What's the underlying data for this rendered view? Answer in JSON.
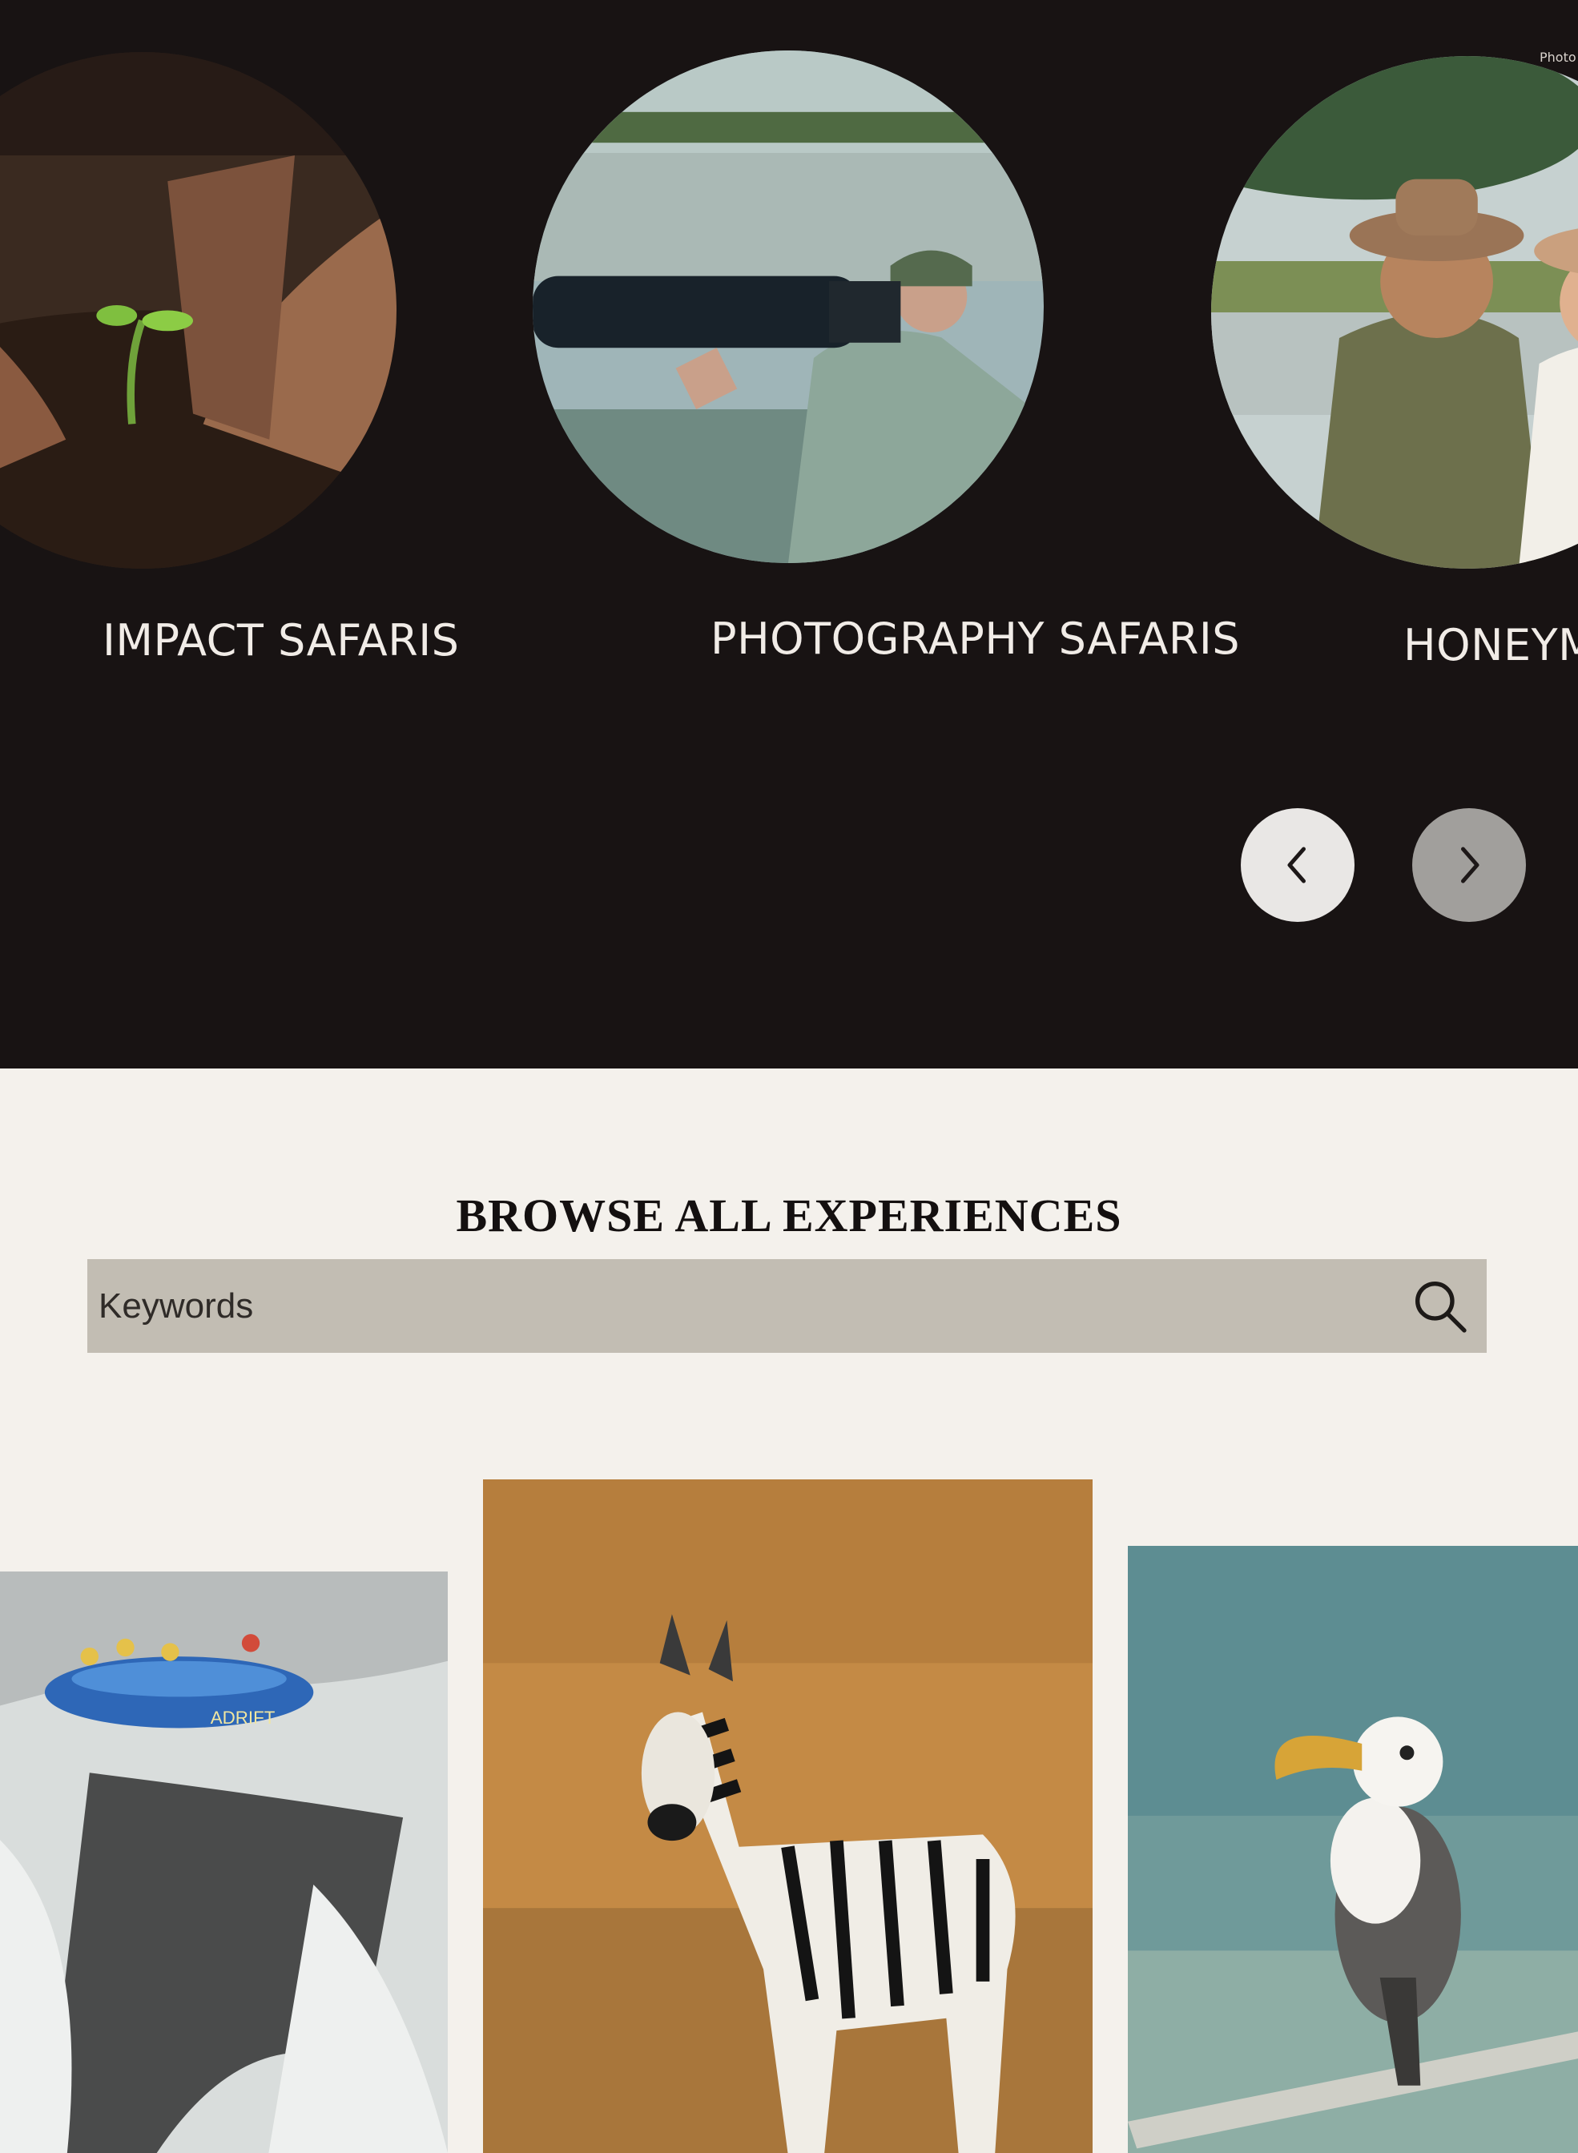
{
  "carousel": {
    "items": [
      {
        "label": "IMPACT SAFARIS",
        "icon": "seedling-photo"
      },
      {
        "label": "PHOTOGRAPHY SAFARIS",
        "icon": "photographer-photo"
      },
      {
        "label": "HONEYM",
        "icon": "couple-photo"
      }
    ],
    "credit": "Photo",
    "prev_icon": "chevron-left-icon",
    "next_icon": "chevron-right-icon"
  },
  "browse": {
    "title": "BROWSE ALL EXPERIENCES",
    "search_placeholder": "Keywords",
    "search_icon": "search-icon"
  },
  "experiences": {
    "cards": [
      {
        "icon": "rafting-photo",
        "raft_text": "ADRIFT"
      },
      {
        "icon": "zebra-photo"
      },
      {
        "icon": "hornbill-photo"
      }
    ]
  },
  "colors": {
    "dark_band": "#181313",
    "page_bg": "#f4f1ec",
    "search_bg": "#c2bdb3"
  }
}
